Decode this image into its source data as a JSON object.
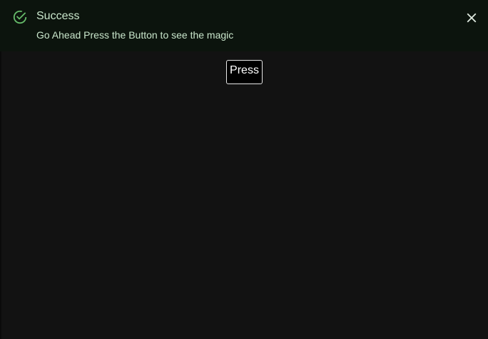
{
  "alert": {
    "severity": "success",
    "title": "Success",
    "message": "Go Ahead Press the Button to see the magic",
    "icon": "check-circle-icon",
    "close_icon": "close-icon",
    "accent_color": "#66bb6a",
    "background_color": "#0c140d",
    "text_color": "#c9e6cb"
  },
  "main": {
    "button_label": "Press",
    "background_color": "#121212"
  }
}
